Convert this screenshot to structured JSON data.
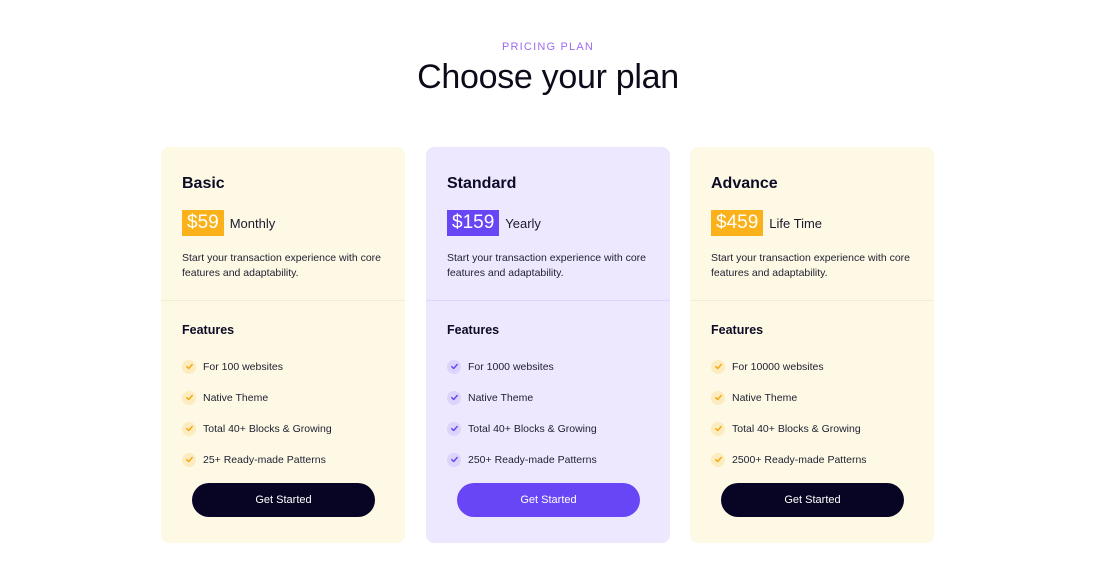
{
  "header": {
    "eyebrow": "PRICING PLAN",
    "title": "Choose your plan"
  },
  "colors": {
    "accent_yellow": "#fbb11a",
    "accent_purple": "#6846f5",
    "card_yellow_bg": "#fdf9e5",
    "card_purple_bg": "#ede8fe",
    "dark_button": "#070523",
    "eyebrow": "#9b6cf0"
  },
  "plans": [
    {
      "name": "Basic",
      "price": "$59",
      "period": "Monthly",
      "description": "Start your transaction experience with core features and adaptability.",
      "features_title": "Features",
      "features": [
        "For 100 websites",
        "Native Theme",
        "Total 40+ Blocks & Growing",
        "25+ Ready-made Patterns"
      ],
      "cta": "Get Started"
    },
    {
      "name": "Standard",
      "price": "$159",
      "period": "Yearly",
      "description": "Start your transaction experience with core features and adaptability.",
      "features_title": "Features",
      "features": [
        "For 1000 websites",
        "Native Theme",
        "Total 40+ Blocks & Growing",
        "250+ Ready-made Patterns"
      ],
      "cta": "Get Started"
    },
    {
      "name": "Advance",
      "price": "$459",
      "period": "Life Time",
      "description": "Start your transaction experience with core features and adaptability.",
      "features_title": "Features",
      "features": [
        "For 10000 websites",
        "Native Theme",
        "Total 40+ Blocks & Growing",
        "2500+ Ready-made Patterns"
      ],
      "cta": "Get Started"
    }
  ],
  "icons": {
    "feature_check": "check-icon"
  }
}
